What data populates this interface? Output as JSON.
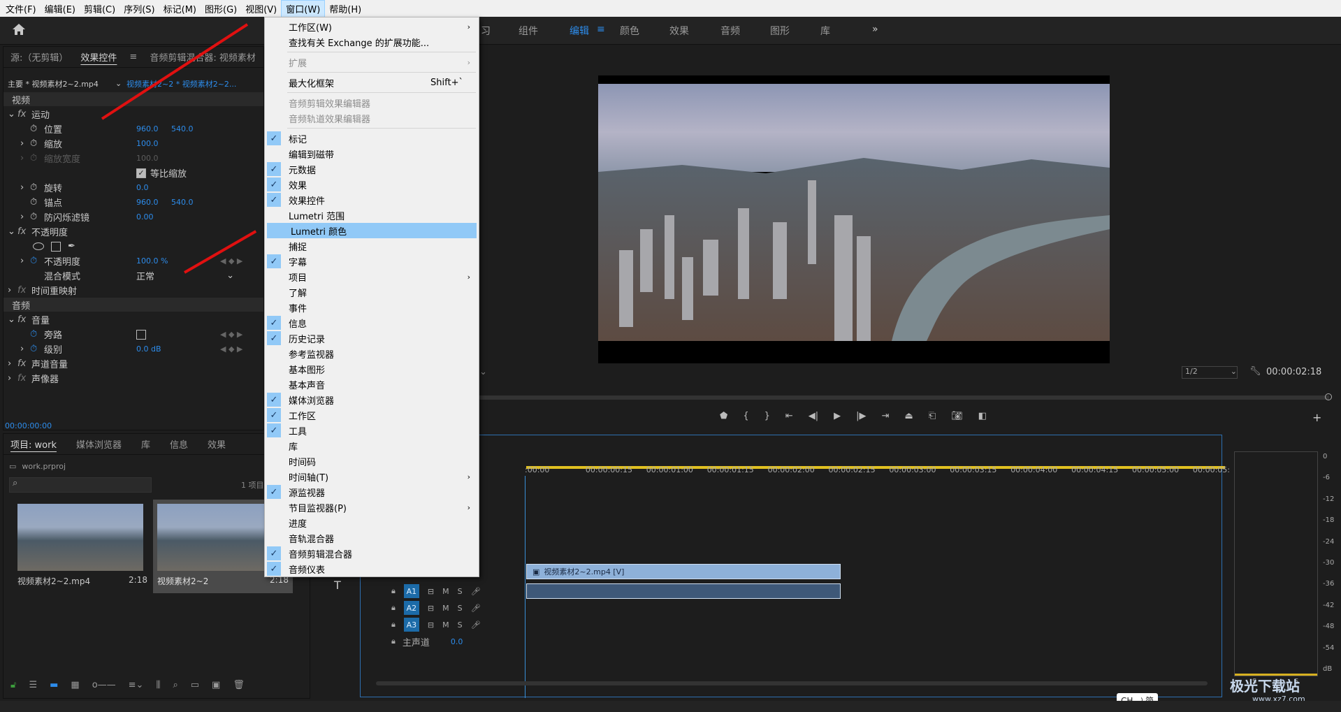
{
  "menubar": {
    "items": [
      "文件(F)",
      "编辑(E)",
      "剪辑(C)",
      "序列(S)",
      "标记(M)",
      "图形(G)",
      "视图(V)",
      "窗口(W)",
      "帮助(H)"
    ],
    "active": "窗口(W)"
  },
  "workspace": {
    "tabs": [
      "习",
      "组件",
      "编辑",
      "颜色",
      "效果",
      "音频",
      "图形",
      "库"
    ],
    "selected": "编辑",
    "more": "»"
  },
  "effect_panel": {
    "tabs": [
      "源:（无剪辑）",
      "效果控件",
      "音频剪辑混合器: 视频素材"
    ],
    "master": "主要 * 视频素材2~2.mp4",
    "sequence": "视频素材2~2 * 视频素材2~2...",
    "video_hdr": "视频",
    "motion": "运动",
    "position": "位置",
    "pos_x": "960.0",
    "pos_y": "540.0",
    "scale": "缩放",
    "scale_val": "100.0",
    "scale_w": "缩放宽度",
    "scale_w_val": "100.0",
    "uniform": "等比缩放",
    "rotation": "旋转",
    "rotation_val": "0.0",
    "anchor": "锚点",
    "anchor_x": "960.0",
    "anchor_y": "540.0",
    "antiflicker": "防闪烁滤镜",
    "antiflicker_val": "0.00",
    "opacity_sec": "不透明度",
    "opacity": "不透明度",
    "opacity_val": "100.0 %",
    "blend": "混合模式",
    "blend_val": "正常",
    "timeremap": "时间重映射",
    "audio_hdr": "音频",
    "volume": "音量",
    "bypass": "旁路",
    "level": "级别",
    "level_val": "0.0 dB",
    "channel": "声道音量",
    "panner": "声像器",
    "timecode": "00:00:00:00"
  },
  "project_panel": {
    "tabs": [
      "项目: work",
      "媒体浏览器",
      "库",
      "信息",
      "效果"
    ],
    "file": "work.prproj",
    "count": "1 项目",
    "items": [
      {
        "name": "视频素材2~2.mp4",
        "dur": "2:18"
      },
      {
        "name": "视频素材2~2",
        "dur": "2:18"
      }
    ]
  },
  "menu": {
    "items": [
      {
        "label": "工作区(W)",
        "arrow": true
      },
      {
        "label": "查找有关 Exchange 的扩展功能..."
      },
      {
        "sep": true
      },
      {
        "label": "扩展",
        "arrow": true,
        "disabled": true
      },
      {
        "sep": true
      },
      {
        "label": "最大化框架",
        "shortcut": "Shift+`"
      },
      {
        "sep": true
      },
      {
        "label": "音频剪辑效果编辑器",
        "disabled": true
      },
      {
        "label": "音频轨道效果编辑器",
        "disabled": true
      },
      {
        "sep": true
      },
      {
        "label": "标记",
        "checked": true
      },
      {
        "label": "编辑到磁带"
      },
      {
        "label": "元数据",
        "checked": true
      },
      {
        "label": "效果",
        "checked": true
      },
      {
        "label": "效果控件",
        "checked": true
      },
      {
        "label": "Lumetri 范围"
      },
      {
        "label": "Lumetri 颜色",
        "highlight": true
      },
      {
        "label": "捕捉"
      },
      {
        "label": "字幕",
        "checked": true
      },
      {
        "label": "项目",
        "arrow": true
      },
      {
        "label": "了解"
      },
      {
        "label": "事件"
      },
      {
        "label": "信息",
        "checked": true
      },
      {
        "label": "历史记录",
        "checked": true
      },
      {
        "label": "参考监视器"
      },
      {
        "label": "基本图形"
      },
      {
        "label": "基本声音"
      },
      {
        "label": "媒体浏览器",
        "checked": true
      },
      {
        "label": "工作区",
        "checked": true
      },
      {
        "label": "工具",
        "checked": true
      },
      {
        "label": "库"
      },
      {
        "label": "时间码"
      },
      {
        "label": "时间轴(T)",
        "arrow": true
      },
      {
        "label": "源监视器",
        "checked": true
      },
      {
        "label": "节目监视器(P)",
        "arrow": true
      },
      {
        "label": "进度"
      },
      {
        "label": "音轨混合器"
      },
      {
        "label": "音频剪辑混合器",
        "checked": true
      },
      {
        "label": "音频仪表",
        "checked": true
      }
    ]
  },
  "program": {
    "zoom": "1/2",
    "timecode": "00:00:02:18"
  },
  "timeline": {
    "ruler": [
      ":00:00",
      "00:00:00:15",
      "00:00:01:00",
      "00:00:01:15",
      "00:00:02:00",
      "00:00:02:15",
      "00:00:03:00",
      "00:00:03:15",
      "00:00:04:00",
      "00:00:04:15",
      "00:00:05:00",
      "00:00:05:"
    ],
    "clip_v": "视频素材2~2.mp4 [V]",
    "tracks": [
      "A1",
      "A2",
      "A3"
    ],
    "master": "主声道",
    "master_val": "0.0"
  },
  "meter": {
    "scale": [
      "0",
      "-6",
      "-12",
      "-18",
      "-24",
      "-30",
      "-36",
      "-42",
      "-48",
      "-54",
      "dB"
    ],
    "s": "S"
  },
  "ime": "CH ⤾ 简",
  "watermark": {
    "text": "极光下载站",
    "url": "www.xz7.com"
  },
  "colors": {
    "accent": "#2d8ceb",
    "menu_highlight": "#91c9f7",
    "arrow": "#e01010"
  }
}
